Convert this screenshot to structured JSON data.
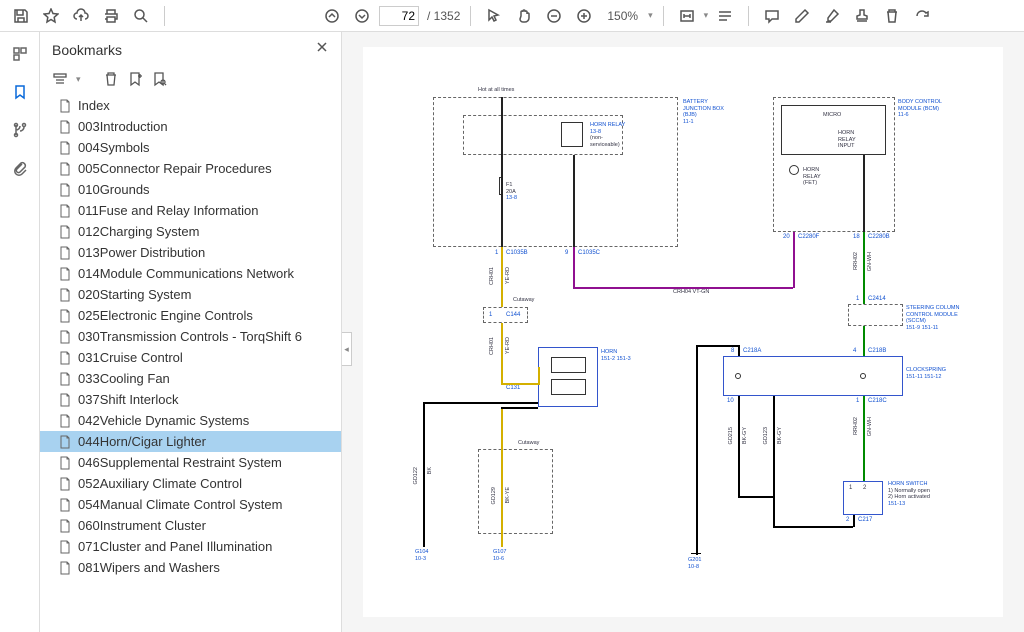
{
  "toolbar": {
    "page_current": "72",
    "page_total": "/ 1352",
    "zoom_value": "150%"
  },
  "bookmarks": {
    "title": "Bookmarks",
    "items": [
      {
        "label": "Index",
        "sel": false
      },
      {
        "label": "003Introduction",
        "sel": false
      },
      {
        "label": "004Symbols",
        "sel": false
      },
      {
        "label": "005Connector Repair Procedures",
        "sel": false
      },
      {
        "label": "010Grounds",
        "sel": false
      },
      {
        "label": "011Fuse and Relay Information",
        "sel": false
      },
      {
        "label": "012Charging System",
        "sel": false
      },
      {
        "label": "013Power Distribution",
        "sel": false
      },
      {
        "label": "014Module Communications Network",
        "sel": false
      },
      {
        "label": "020Starting System",
        "sel": false
      },
      {
        "label": "025Electronic Engine Controls",
        "sel": false
      },
      {
        "label": "030Transmission Controls - TorqShift 6",
        "sel": false
      },
      {
        "label": "031Cruise Control",
        "sel": false
      },
      {
        "label": "033Cooling Fan",
        "sel": false
      },
      {
        "label": "037Shift Interlock",
        "sel": false
      },
      {
        "label": "042Vehicle Dynamic Systems",
        "sel": false
      },
      {
        "label": "044Horn/Cigar Lighter",
        "sel": true
      },
      {
        "label": "046Supplemental Restraint System",
        "sel": false
      },
      {
        "label": "052Auxiliary Climate Control",
        "sel": false
      },
      {
        "label": "054Manual Climate Control System",
        "sel": false
      },
      {
        "label": "060Instrument Cluster",
        "sel": false
      },
      {
        "label": "071Cluster and Panel Illumination",
        "sel": false
      },
      {
        "label": "081Wipers and Washers",
        "sel": false
      }
    ]
  },
  "diagram": {
    "hot_label": "Hot at all times",
    "bjb": {
      "title": "BATTERY JUNCTION BOX (BJB)",
      "ref": "11-1"
    },
    "horn_relay": {
      "title": "HORN RELAY",
      "ref": "13-8",
      "note": "(non-serviceable)"
    },
    "fuse": {
      "name": "F1",
      "rating": "20A",
      "ref": "13-8"
    },
    "bcm": {
      "title": "BODY CONTROL MODULE (BCM)",
      "ref": "11-6"
    },
    "micro": "MICRO",
    "horn_relay_input": "HORN RELAY INPUT",
    "horn_relay_fet": "HORN RELAY (FET)",
    "sccm": {
      "title": "STEERING COLUMN CONTROL MODULE (SCCM)",
      "ref": "151-9  151-11"
    },
    "clockspring": {
      "title": "CLOCKSPRING",
      "ref": "151-11 151-12"
    },
    "horn_switch": {
      "title": "HORN SWITCH",
      "note1": "1) Normally open",
      "note2": "2) Horn activated",
      "ref": "151-13"
    },
    "horn": {
      "title": "HORN",
      "ref": "151-2 151-3"
    },
    "conns": {
      "c1035b": "C1035B",
      "c1035c": "C1035C",
      "c2280f": "C2280F",
      "c2280b": "C2280B",
      "c2414": "C2414",
      "c218a": "C218A",
      "c218b": "C218B",
      "c218c": "C218C",
      "c144": "C144",
      "c131": "C131",
      "c217": "C217"
    },
    "grounds": {
      "g104": {
        "name": "G104",
        "ref": "10-3"
      },
      "g107": {
        "name": "G107",
        "ref": "10-6"
      },
      "g201": {
        "name": "G201",
        "ref": "10-8"
      }
    },
    "wires": {
      "crh01": "CRH01",
      "ye_rd": "YE-RD",
      "crh04": "CRH04 VT-GN",
      "rrh02": "RRH02",
      "gn_wh": "GN-WH",
      "gd122": "GD122",
      "gd129": "GD129",
      "gd215": "GD215",
      "gd123": "GD123",
      "bk": "BK",
      "bk_ye": "BK-YE",
      "bk_gy": "BK-GY",
      "cutaway": "Cutaway"
    },
    "pins": {
      "p1": "1",
      "p2": "2",
      "p4": "4",
      "p8": "8",
      "p9": "9",
      "p10": "10",
      "p18": "18",
      "p20": "20"
    }
  }
}
